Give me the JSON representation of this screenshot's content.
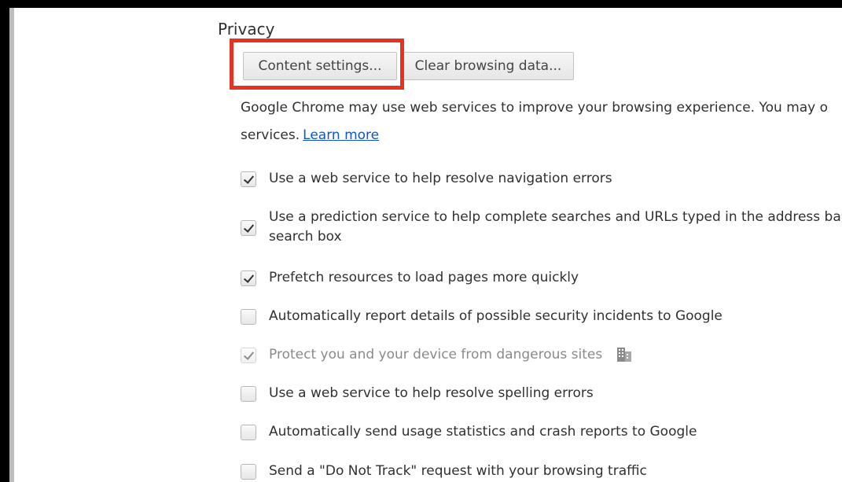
{
  "privacy": {
    "title": "Privacy",
    "content_settings_label": "Content settings...",
    "clear_browsing_label": "Clear browsing data...",
    "description_line1": "Google Chrome may use web services to improve your browsing experience. You may o",
    "description_line2": "services.",
    "learn_more": "Learn more",
    "options": [
      {
        "label_line1": "Use a web service to help resolve navigation errors",
        "label_line2": "",
        "checked": true,
        "disabled": false
      },
      {
        "label_line1": "Use a prediction service to help complete searches and URLs typed in the address ba",
        "label_line2": "search box",
        "checked": true,
        "disabled": false
      },
      {
        "label_line1": "Prefetch resources to load pages more quickly",
        "label_line2": "",
        "checked": true,
        "disabled": false
      },
      {
        "label_line1": "Automatically report details of possible security incidents to Google",
        "label_line2": "",
        "checked": false,
        "disabled": false
      },
      {
        "label_line1": "Protect you and your device from dangerous sites",
        "label_line2": "",
        "checked": true,
        "disabled": true,
        "icon": "enterprise-policy-icon"
      },
      {
        "label_line1": "Use a web service to help resolve spelling errors",
        "label_line2": "",
        "checked": false,
        "disabled": false
      },
      {
        "label_line1": "Automatically send usage statistics and crash reports to Google",
        "label_line2": "",
        "checked": false,
        "disabled": false
      },
      {
        "label_line1": "Send a \"Do Not Track\" request with your browsing traffic",
        "label_line2": "",
        "checked": false,
        "disabled": false
      }
    ]
  },
  "colors": {
    "highlight": "#e53323",
    "link": "#1155cc",
    "background": "#000000"
  }
}
